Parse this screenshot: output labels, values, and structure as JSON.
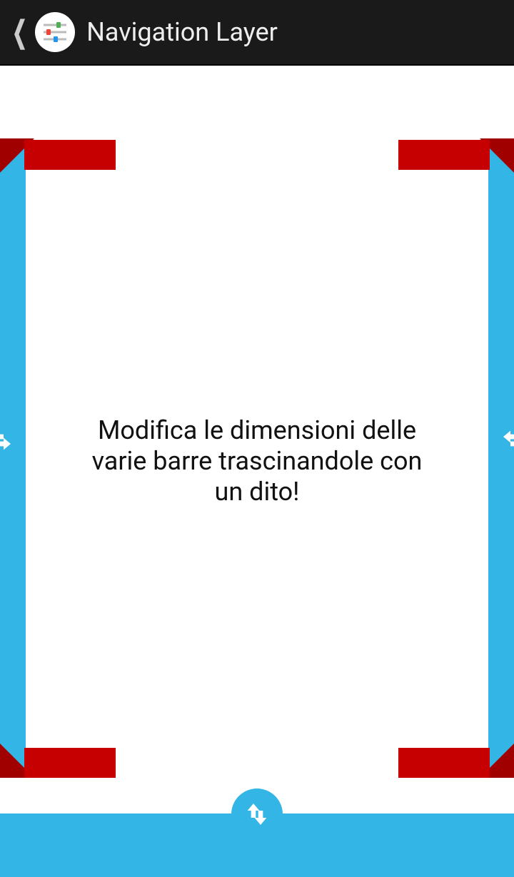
{
  "header": {
    "title": "Navigation Layer"
  },
  "main": {
    "instruction_text": "Modifica le dimensioni delle varie barre trascinandole con un dito!"
  },
  "colors": {
    "accent": "#33b5e5",
    "bar_marker": "#c60000",
    "bar_marker_dark": "#a00000",
    "header_bg": "#1a1a1a"
  },
  "icons": {
    "back": "chevron-left-icon",
    "app": "sliders-icon",
    "horizontal_handle": "swap-horizontal-icon",
    "vertical_handle": "swap-vertical-icon"
  }
}
